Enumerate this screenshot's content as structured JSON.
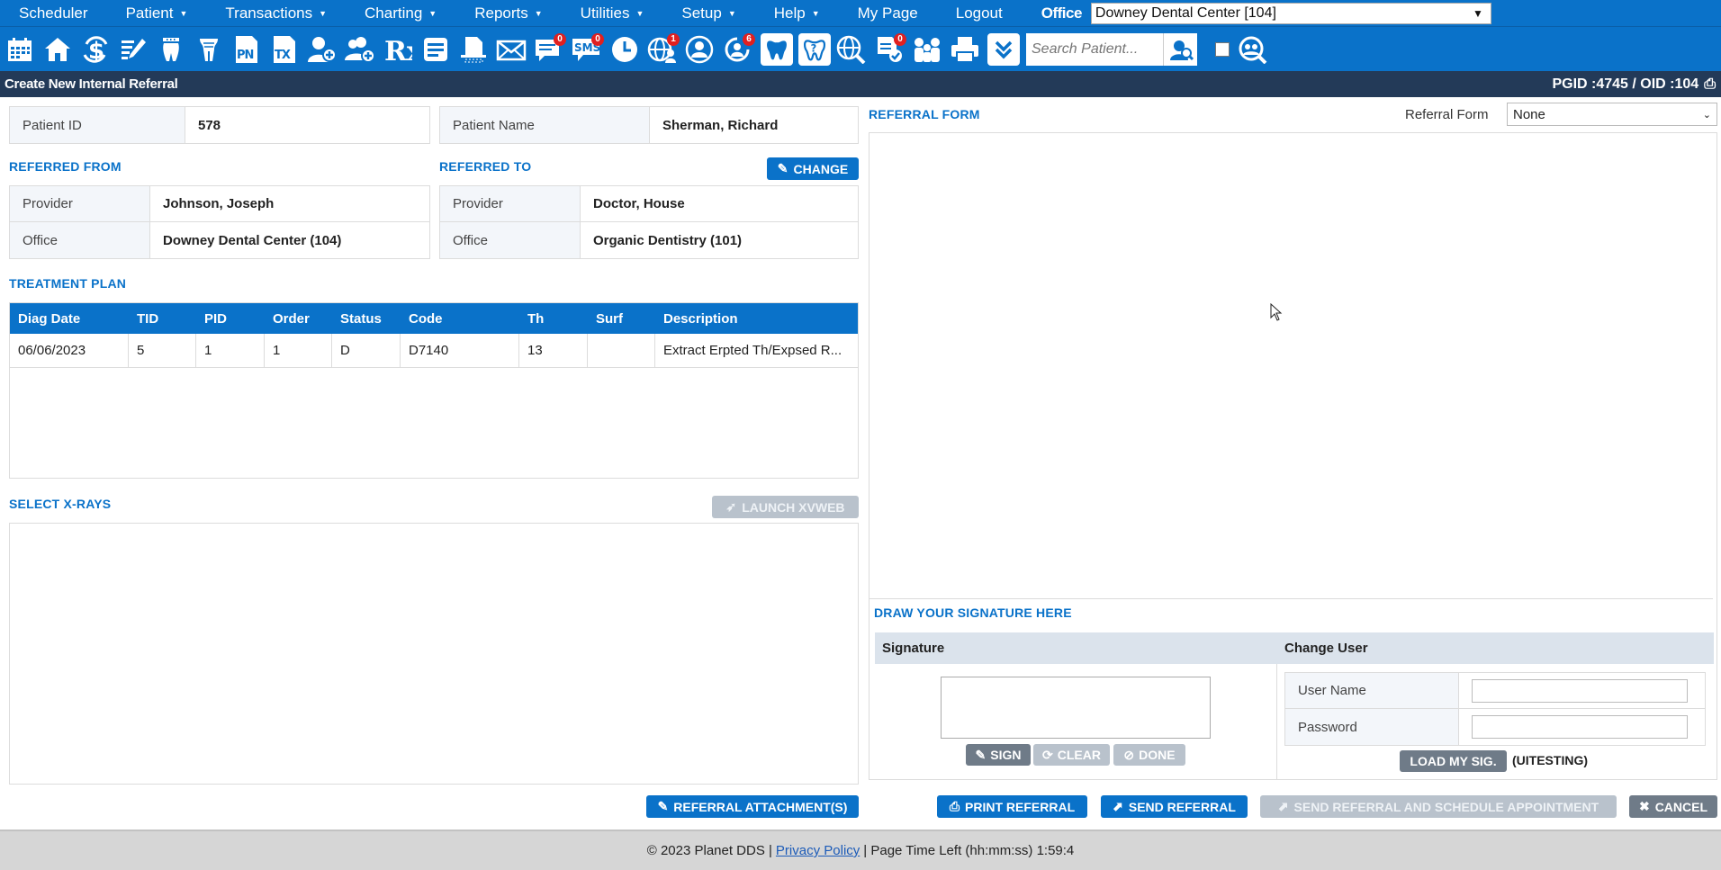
{
  "menu": {
    "items": [
      {
        "label": "Scheduler",
        "caret": false
      },
      {
        "label": "Patient",
        "caret": true
      },
      {
        "label": "Transactions",
        "caret": true
      },
      {
        "label": "Charting",
        "caret": true
      },
      {
        "label": "Reports",
        "caret": true
      },
      {
        "label": "Utilities",
        "caret": true
      },
      {
        "label": "Setup",
        "caret": true
      },
      {
        "label": "Help",
        "caret": true
      },
      {
        "label": "My Page",
        "caret": false
      },
      {
        "label": "Logout",
        "caret": false
      }
    ],
    "office_label": "Office",
    "office_value": "Downey Dental Center [104]"
  },
  "toolbar": {
    "search_placeholder": "Search Patient...",
    "badges": {
      "messages": "0",
      "sms": "0",
      "globe": "1",
      "recall": "6",
      "docs": "0"
    },
    "pn": "PN",
    "tx": "TX",
    "rx": "Rx",
    "sms": "SMS"
  },
  "titlebar": {
    "title": "Create New Internal Referral",
    "ids": "PGID :4745  /  OID :104"
  },
  "patient": {
    "id_label": "Patient ID",
    "id_value": "578",
    "name_label": "Patient Name",
    "name_value": "Sherman, Richard"
  },
  "referred_from": {
    "title": "REFERRED FROM",
    "provider_label": "Provider",
    "provider_value": "Johnson, Joseph",
    "office_label": "Office",
    "office_value": "Downey Dental Center (104)"
  },
  "referred_to": {
    "title": "REFERRED TO",
    "change_label": "CHANGE",
    "provider_label": "Provider",
    "provider_value": "Doctor, House",
    "office_label": "Office",
    "office_value": "Organic Dentistry (101)"
  },
  "treatment_plan": {
    "title": "TREATMENT PLAN",
    "columns": [
      "Diag Date",
      "TID",
      "PID",
      "Order",
      "Status",
      "Code",
      "Th",
      "Surf",
      "Description"
    ],
    "rows": [
      [
        "06/06/2023",
        "5",
        "1",
        "1",
        "D",
        "D7140",
        "13",
        "",
        "Extract Erpted Th/Expsed R..."
      ]
    ]
  },
  "xrays": {
    "title": "SELECT X-RAYS",
    "launch_label": "LAUNCH XVWEB"
  },
  "referral_form": {
    "title": "REFERRAL FORM",
    "select_label": "Referral Form",
    "select_value": "None"
  },
  "signature": {
    "title": "DRAW YOUR SIGNATURE HERE",
    "col_signature": "Signature",
    "col_change_user": "Change User",
    "sign_label": "SIGN",
    "clear_label": "CLEAR",
    "done_label": "DONE",
    "username_label": "User Name",
    "password_label": "Password",
    "load_label": "LOAD MY SIG.",
    "user_tag": "(UITESTING)"
  },
  "actions": {
    "attachments": "REFERRAL ATTACHMENT(S)",
    "print": "PRINT REFERRAL",
    "send": "SEND REFERRAL",
    "send_schedule": "SEND REFERRAL AND SCHEDULE APPOINTMENT",
    "cancel": "CANCEL"
  },
  "footer": {
    "copyright": "© 2023 Planet DDS |",
    "privacy": "Privacy Policy",
    "time_left": "|  Page Time Left (hh:mm:ss) 1:59:4"
  },
  "colors": {
    "brand_blue": "#0a72c9",
    "title_bar": "#233a58",
    "badge_red": "#e02020"
  }
}
